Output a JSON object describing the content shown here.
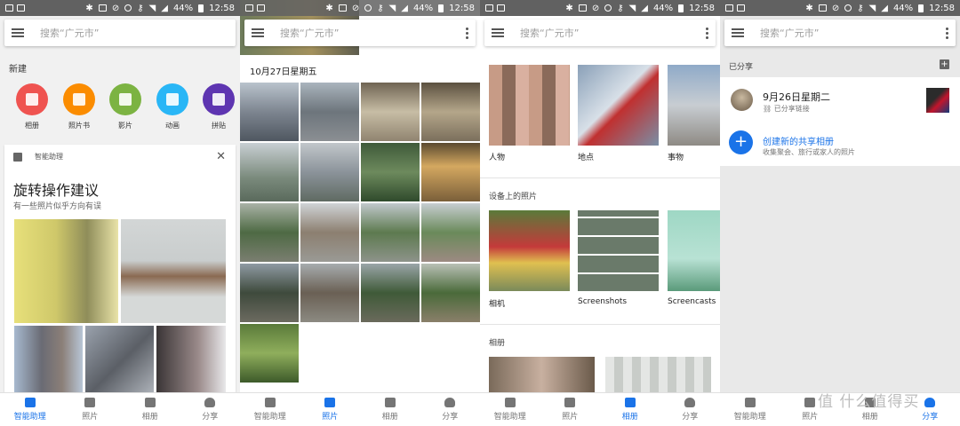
{
  "status": {
    "battery": "44%",
    "time": "12:58"
  },
  "search": {
    "placeholder": "搜索“广元市”"
  },
  "nav": {
    "tabs": [
      "智能助理",
      "照片",
      "相册",
      "分享"
    ]
  },
  "assistant": {
    "new_label": "新建",
    "create": [
      {
        "label": "相册",
        "color": "#ef5350"
      },
      {
        "label": "照片书",
        "color": "#fb8c00"
      },
      {
        "label": "影片",
        "color": "#7cb342"
      },
      {
        "label": "动画",
        "color": "#29b6f6"
      },
      {
        "label": "拼贴",
        "color": "#5e35b1"
      }
    ],
    "card": {
      "header": "智能助理",
      "title": "旋转操作建议",
      "subtitle": "有一些照片似乎方向有误"
    }
  },
  "photos": {
    "date": "10月27日星期五"
  },
  "albums": {
    "categories": [
      "人物",
      "地点",
      "事物"
    ],
    "device_section": "设备上的照片",
    "device_folders": [
      "相机",
      "Screenshots",
      "Screencasts"
    ],
    "albums_section": "相册"
  },
  "sharing": {
    "header": "已分享",
    "item": {
      "date": "9月26日星期二",
      "status": "已分享链接"
    },
    "new_album": {
      "title": "创建新的共享相册",
      "subtitle": "收集聚会、旅行或家人的照片"
    }
  },
  "watermark": "值 什么值得买",
  "colors": {
    "accent": "#1a73e8",
    "status_bar": "#616161"
  }
}
